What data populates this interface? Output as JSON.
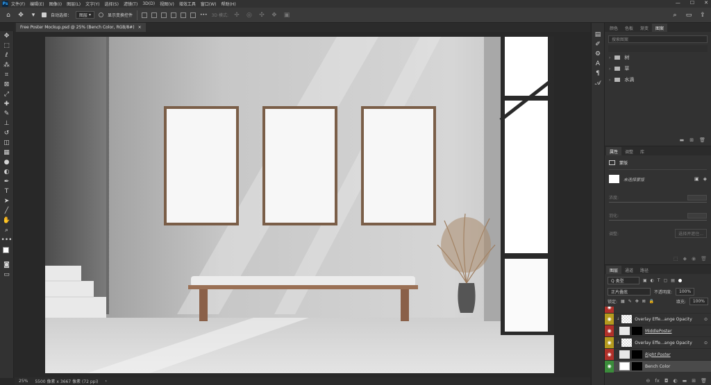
{
  "app": {
    "logo": "Ps"
  },
  "menu": [
    "文件(F)",
    "编辑(E)",
    "图像(I)",
    "图层(L)",
    "文字(Y)",
    "选择(S)",
    "滤镜(T)",
    "3D(D)",
    "视图(V)",
    "增效工具",
    "窗口(W)",
    "帮助(H)"
  ],
  "window_controls": {
    "minimize": "—",
    "maximize": "☐",
    "close": "✕"
  },
  "options": {
    "auto_select_label": "自动选择：",
    "auto_select_target": "图层",
    "show_transform_label": "显示变换控件",
    "mode_3d_label": "3D 模式:",
    "more": "•••"
  },
  "tools": [
    "move-icon",
    "marquee-icon",
    "lasso-icon",
    "magic-wand-icon",
    "crop-icon",
    "frame-icon",
    "eyedropper-icon",
    "healing-icon",
    "brush-icon",
    "stamp-icon",
    "history-brush-icon",
    "eraser-icon",
    "gradient-icon",
    "blur-icon",
    "dodge-icon",
    "pen-icon",
    "type-icon",
    "path-select-icon",
    "line-icon",
    "hand-icon",
    "zoom-icon",
    "more-tools-icon"
  ],
  "document": {
    "tab_title": "Free Poster Mockup.psd @ 25% (Bench Color, RGB/8#)",
    "close": "×"
  },
  "status": {
    "zoom": "25%",
    "size": "5500 像素 x 3667 像素 (72 ppi)"
  },
  "colors": {
    "accent": "#31a8ff",
    "eye_red": "#b0312a",
    "eye_yellow": "#b59a1e",
    "eye_green": "#3b8c3b",
    "panel_bg": "#323232",
    "app_bg": "#282828"
  },
  "panel_top": {
    "tabs": [
      "颜色",
      "色板",
      "渐变",
      "图案"
    ],
    "active_tab": 3,
    "search_placeholder": "搜索图案",
    "folders": [
      "树",
      "草",
      "水滴"
    ]
  },
  "properties": {
    "tabs": [
      "属性",
      "调整",
      "库"
    ],
    "active_tab": 0,
    "section": "蒙版",
    "mask_label": "未选择蒙版",
    "density_label": "浓度:",
    "feather_label": "羽化:",
    "adjust_label": "调整:",
    "select_subject_label": "选择并遮住..."
  },
  "layers": {
    "tabs": [
      "图层",
      "通道",
      "路径"
    ],
    "active_tab": 0,
    "kind_label": "Q 类型",
    "blend_mode": "正片叠底",
    "opacity_label": "不透明度:",
    "opacity_value": "100%",
    "lock_label": "锁定:",
    "fill_label": "填充:",
    "fill_value": "100%",
    "items": [
      {
        "name": "Overlay Effe...ange Opacity",
        "thumb": "checker",
        "color": "yellow"
      },
      {
        "name": "MiddlePoster",
        "thumb": "smart",
        "color": "red"
      },
      {
        "name": "Overlay Effe...ange Opacity",
        "thumb": "checker",
        "color": "yellow"
      },
      {
        "name": "Right Poster",
        "thumb": "smart",
        "color": "red"
      },
      {
        "name": "Bench Color",
        "thumb": "adjust",
        "color": "green"
      }
    ]
  }
}
